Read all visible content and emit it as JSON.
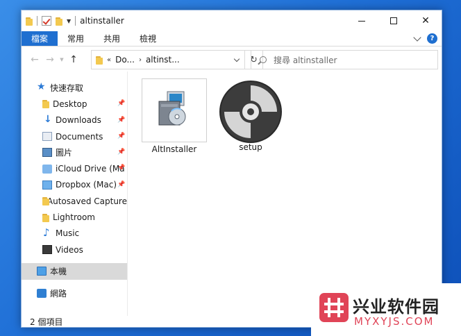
{
  "window": {
    "title": "altinstaller",
    "controls": [
      "minimize",
      "maximize",
      "close"
    ]
  },
  "ribbon": {
    "tabs": [
      {
        "label": "檔案",
        "active": true
      },
      {
        "label": "常用",
        "active": false
      },
      {
        "label": "共用",
        "active": false
      },
      {
        "label": "檢視",
        "active": false
      }
    ],
    "help": "?"
  },
  "address": {
    "crumbs": [
      "Do...",
      "altinst..."
    ],
    "separator": "›",
    "overflow": "«"
  },
  "search": {
    "placeholder": "搜尋 altinstaller"
  },
  "navpane": {
    "quick_access": "快速存取",
    "items": [
      {
        "label": "Desktop",
        "icon": "folder-icon",
        "pinned": true
      },
      {
        "label": "Downloads",
        "icon": "download-icon",
        "pinned": true
      },
      {
        "label": "Documents",
        "icon": "document-icon",
        "pinned": true
      },
      {
        "label": "圖片",
        "icon": "pictures-icon",
        "pinned": true
      },
      {
        "label": "iCloud Drive (Ma",
        "icon": "icloud-icon",
        "pinned": true
      },
      {
        "label": "Dropbox (Mac)",
        "icon": "dropbox-icon",
        "pinned": true
      },
      {
        "label": "Autosaved Capture",
        "icon": "folder-icon",
        "pinned": false
      },
      {
        "label": "Lightroom",
        "icon": "folder-icon",
        "pinned": false
      },
      {
        "label": "Music",
        "icon": "music-icon",
        "pinned": false
      },
      {
        "label": "Videos",
        "icon": "videos-icon",
        "pinned": false
      }
    ],
    "this_pc": "本機",
    "network": "網路"
  },
  "files": [
    {
      "name": "AltInstaller",
      "icon": "installer-icon",
      "selected": true
    },
    {
      "name": "setup",
      "icon": "disc-icon",
      "selected": false
    }
  ],
  "status": {
    "count": "2 個項目"
  },
  "watermark": {
    "cn": "兴业软件园",
    "en": "MYXYJS.COM"
  },
  "colors": {
    "accent": "#1f6fd0",
    "desktop": "#1f6fd6",
    "watermark": "#e04457"
  }
}
